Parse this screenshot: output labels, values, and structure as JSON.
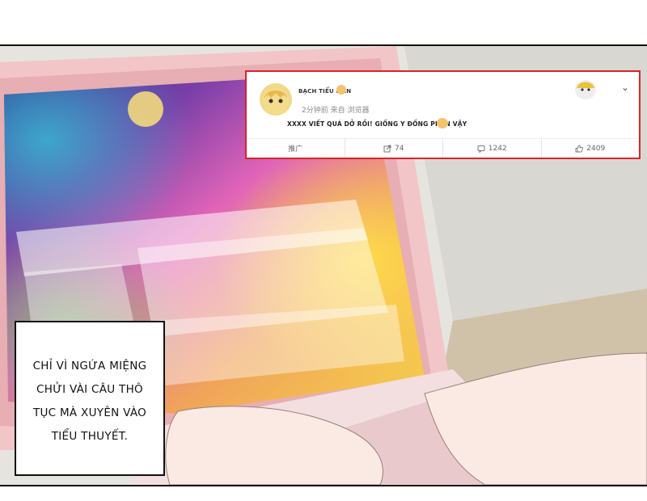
{
  "post": {
    "username": "BẠCH TIỂU MAN",
    "meta": "2分钟前 来自 浏览器",
    "text": "XXXX VIẾT QUÁ DỞ RỒI! GIỐNG Y ĐỐNG PHÂN VẬY",
    "actions": [
      {
        "icon": "promote-icon",
        "label": "推广"
      },
      {
        "icon": "share-icon",
        "label": "74"
      },
      {
        "icon": "comment-icon",
        "label": "1242"
      },
      {
        "icon": "like-icon",
        "label": "2409"
      }
    ],
    "border_color": "#d8232a"
  },
  "caption": {
    "lines": [
      "CHỈ VÌ NGỨA MIỆNG",
      "CHỬI VÀI CÂU THÔ",
      "TỤC MÀ XUYÊN VÀO",
      "TIỂU THUYẾT."
    ]
  }
}
